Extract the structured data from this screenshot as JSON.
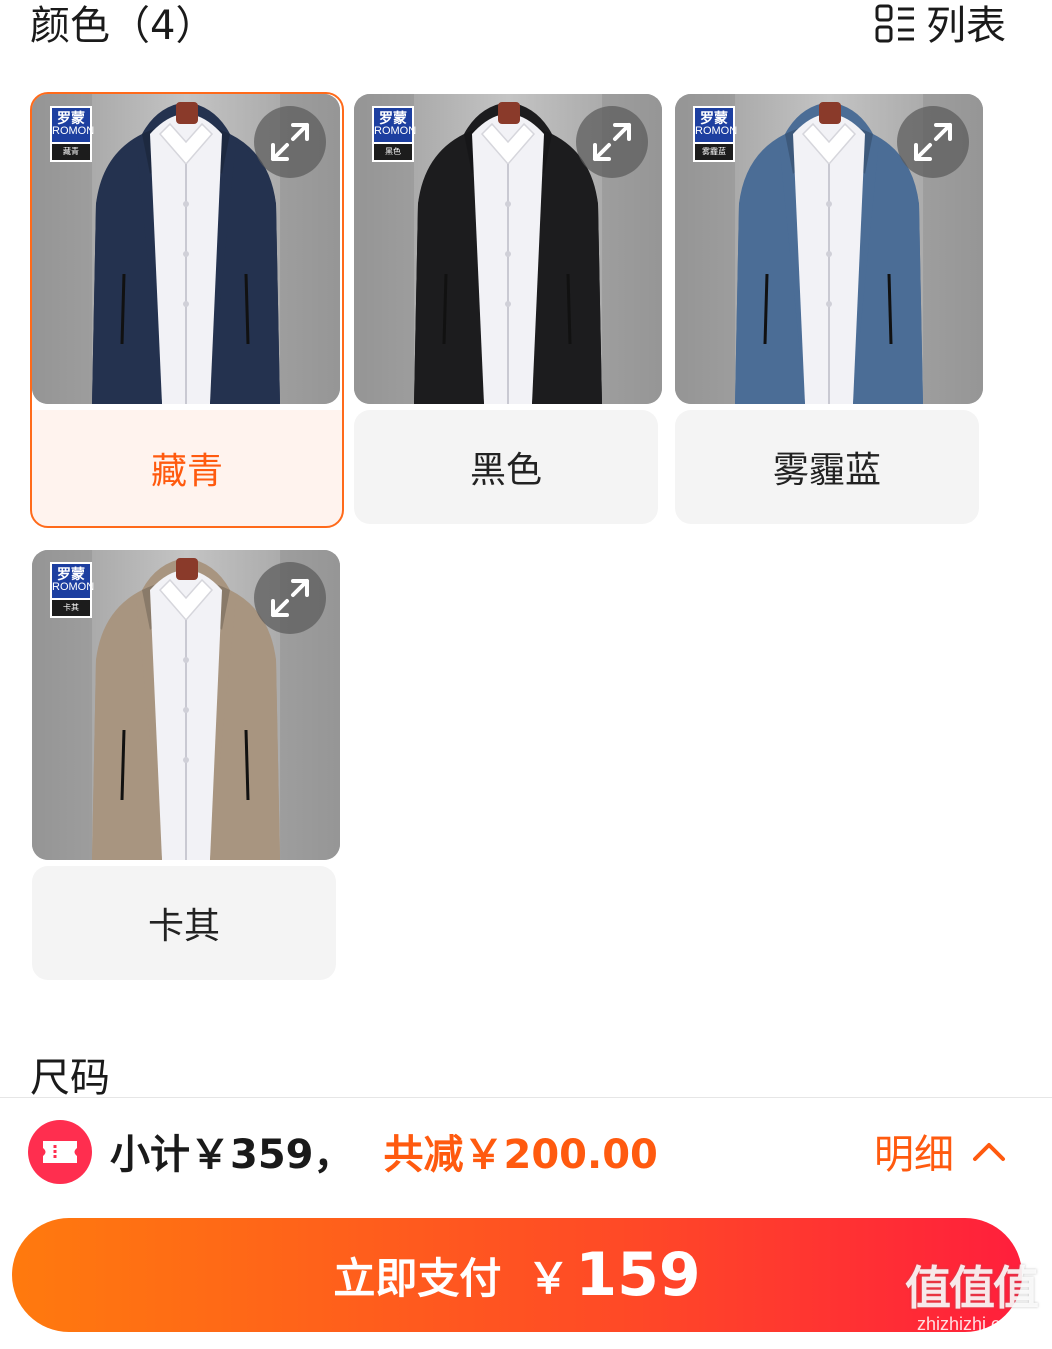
{
  "color_section": {
    "title": "颜色（4）",
    "list_toggle_label": "列表"
  },
  "colors": [
    {
      "label": "藏青",
      "brand_name": "罗蒙",
      "brand_en": "ROMON",
      "tag": "藏青",
      "jacket_color": "#24324f",
      "selected": true
    },
    {
      "label": "黑色",
      "brand_name": "罗蒙",
      "brand_en": "ROMON",
      "tag": "黑色",
      "jacket_color": "#1c1c1e",
      "selected": false
    },
    {
      "label": "雾霾蓝",
      "brand_name": "罗蒙",
      "brand_en": "ROMON",
      "tag": "雾霾蓝",
      "jacket_color": "#4b6d96",
      "selected": false
    },
    {
      "label": "卡其",
      "brand_name": "罗蒙",
      "brand_en": "ROMON",
      "tag": "卡其",
      "jacket_color": "#a89580",
      "selected": false
    }
  ],
  "size_section": {
    "title": "尺码"
  },
  "summary": {
    "subtotal_text": "小计￥359，",
    "discount_text": "共减￥200.00",
    "detail_label": "明细"
  },
  "pay_button": {
    "label": "立即支付",
    "currency": "￥",
    "amount": "159"
  },
  "watermark": {
    "logo": "值值值",
    "url": "zhizhizhi.com"
  },
  "accent_color": "#ff5a0f"
}
